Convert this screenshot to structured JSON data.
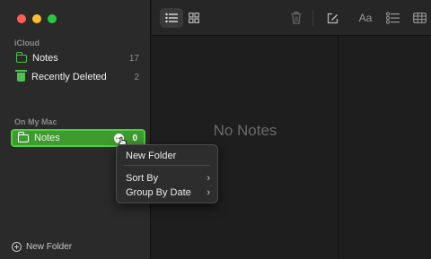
{
  "window": {
    "controls": [
      "close",
      "minimize",
      "zoom"
    ]
  },
  "sidebar": {
    "icloud_label": "iCloud",
    "icloud_items": [
      {
        "label": "Notes",
        "count": "17",
        "icon": "folder-icon"
      },
      {
        "label": "Recently Deleted",
        "count": "2",
        "icon": "trash-icon"
      }
    ],
    "mac_label": "On My Mac",
    "mac_items": [
      {
        "label": "Notes",
        "count": "0",
        "icon": "folder-icon",
        "selected": true
      }
    ],
    "more_glyph": "⋯",
    "new_folder_label": "New Folder"
  },
  "toolbar": {
    "buttons": [
      "list-view-icon",
      "gallery-view-icon",
      "trash-icon",
      "compose-icon",
      "format-icon",
      "checklist-icon",
      "table-icon"
    ],
    "format_label": "Aa"
  },
  "list": {
    "empty_text": "No Notes"
  },
  "context_menu": {
    "items": [
      {
        "label": "New Folder"
      },
      {
        "label": "Sort By",
        "submenu": true
      },
      {
        "label": "Group By Date",
        "submenu": true
      }
    ],
    "chevron": "›"
  },
  "colors": {
    "accent": "#3f9a2f",
    "folder": "#4cc14c"
  }
}
